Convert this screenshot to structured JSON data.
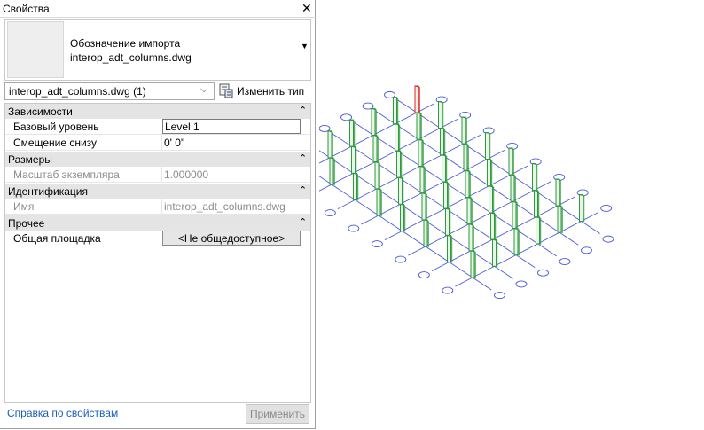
{
  "panel": {
    "title": "Свойства",
    "close_glyph": "✕",
    "type_selector": {
      "line1": "Обозначение импорта",
      "line2": "interop_adt_columns.dwg",
      "arrow_glyph": "▼"
    },
    "instance_selector": {
      "value": "interop_adt_columns.dwg (1)",
      "chevron_glyph": "⌵"
    },
    "edit_type_label": "Изменить тип",
    "collapse_glyph": "⌃",
    "categories": [
      {
        "label": "Зависимости",
        "rows": [
          {
            "name": "Базовый уровень",
            "value": "Level 1"
          },
          {
            "name": "Смещение снизу",
            "value": "0'  0\""
          }
        ]
      },
      {
        "label": "Размеры",
        "rows": [
          {
            "name": "Масштаб экземпляра",
            "value": "1.000000"
          }
        ]
      },
      {
        "label": "Идентификация",
        "rows": [
          {
            "name": "Имя",
            "value": "interop_adt_columns.dwg"
          }
        ]
      },
      {
        "label": "Прочее",
        "rows": [
          {
            "name": "Общая площадка",
            "value": "<Не общедоступное>"
          }
        ]
      }
    ],
    "help_link": "Справка по свойствам",
    "apply_label": "Применить"
  },
  "viewport": {
    "grid_color": "#4a5ad8",
    "column_color": "#2e9a3a",
    "selected_column_color": "#e02020",
    "grid_rows": 6,
    "grid_cols": 8
  }
}
